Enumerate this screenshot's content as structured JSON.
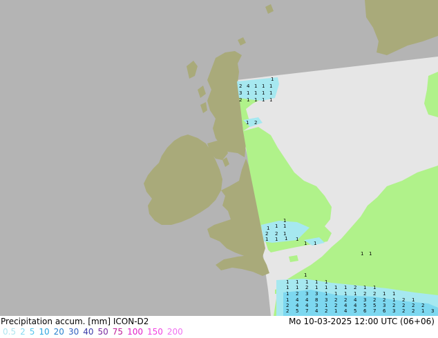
{
  "title": "Precipitation accum. [mm]  ICON-D2",
  "timestamp": "Mo 10-03-2025 12:00 UTC (06+06)",
  "legend": [
    {
      "label": "0.5",
      "color": "#aee6f0"
    },
    {
      "label": "2",
      "color": "#84daf2"
    },
    {
      "label": "5",
      "color": "#57c6ee"
    },
    {
      "label": "10",
      "color": "#2aa5e0"
    },
    {
      "label": "20",
      "color": "#2a82cf"
    },
    {
      "label": "30",
      "color": "#2f5fbf"
    },
    {
      "label": "40",
      "color": "#3a3aa8"
    },
    {
      "label": "50",
      "color": "#7a2aa0"
    },
    {
      "label": "75",
      "color": "#c0209a"
    },
    {
      "label": "100",
      "color": "#e020c8"
    },
    {
      "label": "150",
      "color": "#f040e0"
    },
    {
      "label": "200",
      "color": "#f070f0"
    }
  ],
  "colors": {
    "sea_outside": "#b4b4b4",
    "land_outside": "#a9aa7a",
    "sea_domain": "#e6e6e6",
    "land_domain": "#b0f28a",
    "precip_light": "#a6e8f0",
    "precip_mid": "#7dd8f0"
  },
  "precip_values": {
    "scotland": [
      [
        "2",
        "4",
        "1",
        "1",
        "1"
      ],
      [
        "3",
        "1",
        "1",
        "1",
        "1"
      ],
      [
        "2",
        "1",
        "1",
        "1",
        "1"
      ]
    ],
    "forth": [
      "1",
      "2"
    ],
    "thames": [
      [
        "1"
      ],
      [
        "1",
        "1",
        "1"
      ],
      [
        "2",
        "2",
        "1"
      ],
      [
        "1",
        "1",
        "1",
        "1"
      ],
      [
        "1",
        "1"
      ]
    ],
    "northsea_east": [
      "1",
      "1"
    ],
    "south": [
      [
        "1"
      ],
      [
        "1",
        "1",
        "1",
        "1",
        "1"
      ],
      [
        "1",
        "1",
        "2",
        "1",
        "1",
        "1",
        "1",
        "2",
        "1",
        "1"
      ],
      [
        "1",
        "2",
        "3",
        "3",
        "1",
        "1",
        "1",
        "1",
        "2",
        "2",
        "1",
        "1"
      ],
      [
        "1",
        "4",
        "4",
        "8",
        "3",
        "2",
        "2",
        "4",
        "3",
        "2",
        "2",
        "1",
        "2",
        "1"
      ],
      [
        "2",
        "4",
        "4",
        "3",
        "1",
        "2",
        "4",
        "4",
        "5",
        "5",
        "3",
        "2",
        "2",
        "2",
        "2"
      ],
      [
        "2",
        "5",
        "7",
        "4",
        "2",
        "1",
        "4",
        "5",
        "6",
        "7",
        "6",
        "3",
        "2",
        "2",
        "1",
        "3"
      ],
      [
        "3",
        "7",
        "12",
        "2",
        "1",
        "2",
        "3",
        "7",
        "8",
        "3",
        "2",
        "4",
        "3",
        "3",
        "2"
      ]
    ]
  }
}
